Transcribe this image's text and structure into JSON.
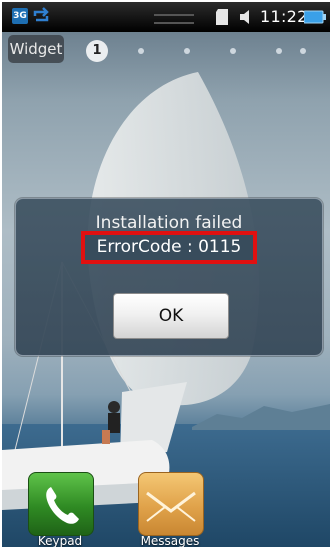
{
  "status_bar": {
    "network": "3G",
    "time": "11:22",
    "icons": [
      "3g-icon",
      "sync-icon",
      "sd-card-icon",
      "volume-icon",
      "battery-icon"
    ]
  },
  "home": {
    "widget_label": "Widget",
    "current_page": "1",
    "page_count": 6
  },
  "dialog": {
    "title": "Installation failed",
    "error_code": "ErrorCode : 0115",
    "ok_label": "OK",
    "highlight_color": "#e01010"
  },
  "dock": [
    {
      "label": "Keypad",
      "icon": "phone-icon"
    },
    {
      "label": "Messages",
      "icon": "envelope-icon"
    }
  ]
}
